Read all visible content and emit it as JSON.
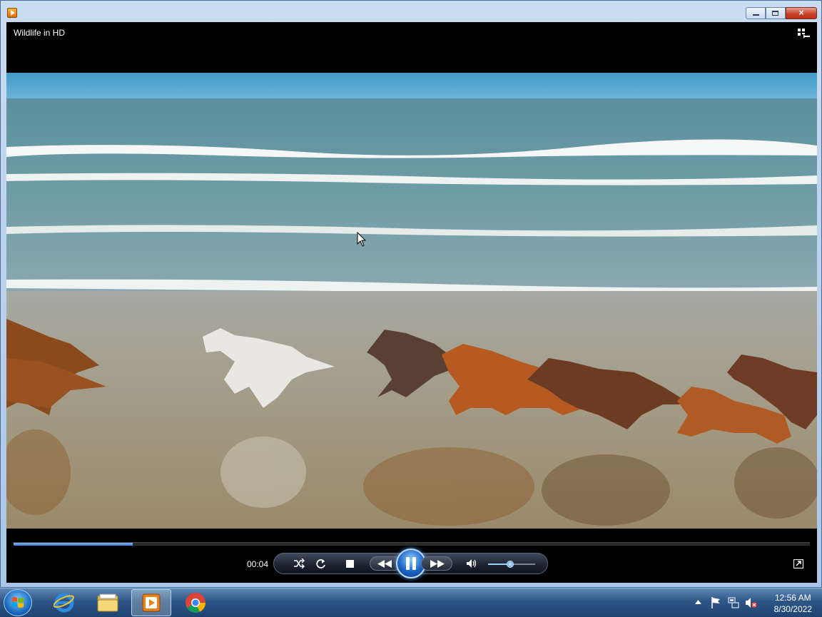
{
  "window": {
    "title_bar_buttons": {
      "minimize": "minimize",
      "maximize": "maximize",
      "close": "×"
    }
  },
  "player": {
    "video_title": "Wildlife in HD",
    "current_time": "00:04",
    "seek_progress_percent": 15,
    "volume_percent": 48,
    "state": "playing"
  },
  "taskbar": {
    "items": [
      "start-button",
      "internet-explorer",
      "windows-explorer",
      "windows-media-player",
      "google-chrome"
    ],
    "active_item": "windows-media-player",
    "clock_time": "12:56 AM",
    "clock_date": "8/30/2022"
  },
  "colors": {
    "accent": "#3d7ae0",
    "window_frame": "#a9c6e8",
    "taskbar": "#2d5586"
  }
}
